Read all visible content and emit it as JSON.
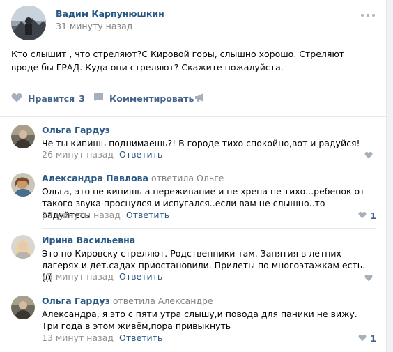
{
  "post": {
    "author": "Вадим Карпунюшкин",
    "time": "31 минуту назад",
    "text": "Кто слышит , что стреляют?С Кировой горы, слышно хорошо. Стреляют вроде бы ГРАД. Куда они стреляют? Скажите пожалуйста.",
    "actions": {
      "like_label": "Нравится",
      "like_count": "3",
      "comment_label": "Комментировать",
      "share_icon": "megaphone-icon"
    }
  },
  "comments": [
    {
      "author": "Ольга Гардуз",
      "reply_to": "",
      "text": "Че ты кипишь поднимаешь?! В городе тихо спокойно,вот и радуйся!",
      "time": "26 минут назад",
      "reply_label": "Ответить",
      "likes": ""
    },
    {
      "author": "Александра Павлова",
      "reply_to": "ответила Ольге",
      "text": "Ольга, это не кипишь а переживание и не хрена не тихо...ребенок от такого звука проснулся и испугался..если вам не слышно..то радуйтесь",
      "time": "23 минуты назад",
      "reply_label": "Ответить",
      "likes": "1"
    },
    {
      "author": "Ирина Васильевна",
      "reply_to": "",
      "text": "Это по Кировску стреляют. Родственники там. Занятия в летних лагерях и дет.садах приостановили. Прилеты по многоэтажкам есть. (((",
      "time": "15 минут назад",
      "reply_label": "Ответить",
      "likes": ""
    },
    {
      "author": "Ольга Гардуз",
      "reply_to": "ответила Александре",
      "text": "Александра, я это с пяти утра слышу,и повода для паники не вижу. Три года в этом живём,пора привыкнуть",
      "time": "13 минут назад",
      "reply_label": "Ответить",
      "likes": "1"
    }
  ],
  "colors": {
    "link": "#2a5885",
    "action": "#42648b",
    "muted": "#828282",
    "icon": "#a6b0bc",
    "divider": "#e7e8ec"
  }
}
